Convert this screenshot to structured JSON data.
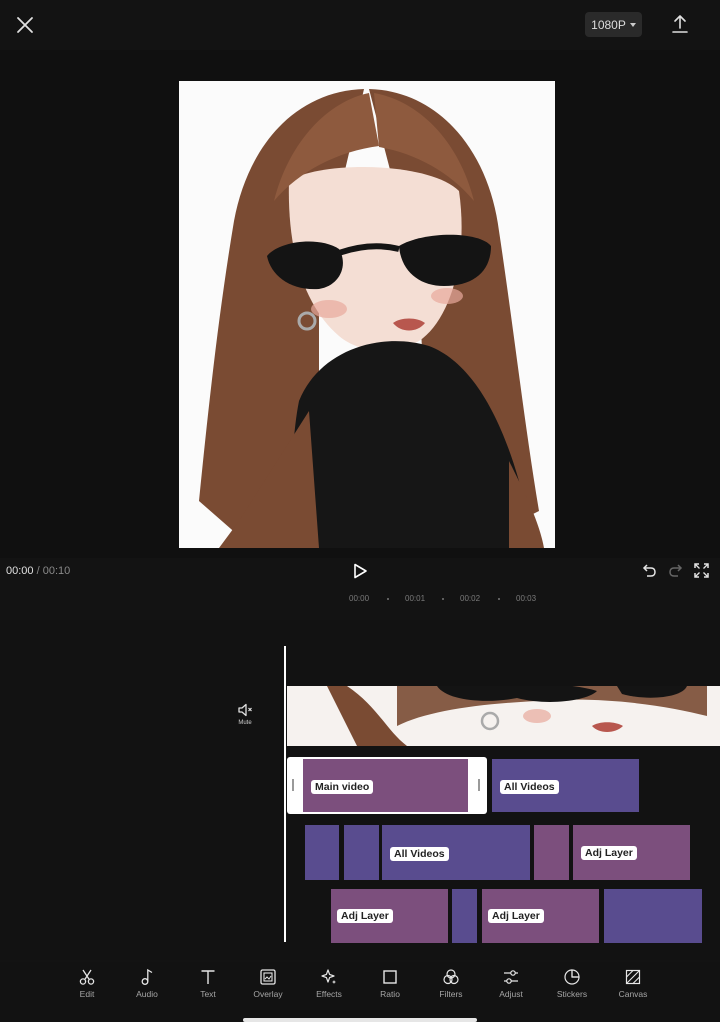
{
  "topbar": {
    "resolution": "1080P"
  },
  "playback": {
    "current": "00:00",
    "separator": "/",
    "total": "00:10"
  },
  "ruler": {
    "ticks": [
      "00:00",
      "00:01",
      "00:02",
      "00:03"
    ]
  },
  "timeline": {
    "mute_label": "Mute",
    "clips": {
      "main": "Main video",
      "all_videos_1": "All Videos",
      "all_videos_2": "All Videos",
      "adj_layer_1": "Adj Layer",
      "adj_layer_2": "Adj Layer",
      "adj_layer_3": "Adj Layer"
    }
  },
  "toolbar": {
    "items": [
      {
        "label": "Edit",
        "icon": "scissors-icon"
      },
      {
        "label": "Audio",
        "icon": "music-note-icon"
      },
      {
        "label": "Text",
        "icon": "text-icon"
      },
      {
        "label": "Overlay",
        "icon": "overlay-icon"
      },
      {
        "label": "Effects",
        "icon": "sparkle-icon"
      },
      {
        "label": "Ratio",
        "icon": "square-icon"
      },
      {
        "label": "Filters",
        "icon": "filters-icon"
      },
      {
        "label": "Adjust",
        "icon": "sliders-icon"
      },
      {
        "label": "Stickers",
        "icon": "sticker-icon"
      },
      {
        "label": "Canvas",
        "icon": "canvas-icon"
      }
    ]
  },
  "colors": {
    "background": "#131313",
    "clip_purple": "#7c4f7d",
    "clip_blue": "#594c8f",
    "playhead": "#ffffff"
  }
}
